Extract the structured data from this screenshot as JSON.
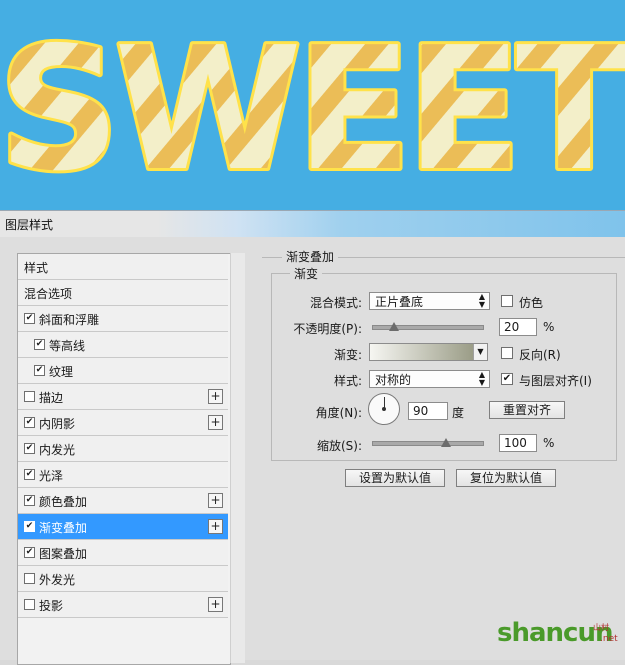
{
  "artwork": {
    "text": "SWEET",
    "background": "#45aee3",
    "fill": "#f3efc9",
    "stripe": "#eab84a",
    "outline": "#ffe24a"
  },
  "dialog_title": "图层样式",
  "style_list": [
    {
      "label": "样式",
      "checkbox": false,
      "checked": false,
      "indent": false,
      "plus": false,
      "selected": false
    },
    {
      "label": "混合选项",
      "checkbox": false,
      "checked": false,
      "indent": false,
      "plus": false,
      "selected": false
    },
    {
      "label": "斜面和浮雕",
      "checkbox": true,
      "checked": true,
      "indent": false,
      "plus": false,
      "selected": false
    },
    {
      "label": "等高线",
      "checkbox": true,
      "checked": true,
      "indent": true,
      "plus": false,
      "selected": false
    },
    {
      "label": "纹理",
      "checkbox": true,
      "checked": true,
      "indent": true,
      "plus": false,
      "selected": false
    },
    {
      "label": "描边",
      "checkbox": true,
      "checked": false,
      "indent": false,
      "plus": true,
      "selected": false
    },
    {
      "label": "内阴影",
      "checkbox": true,
      "checked": true,
      "indent": false,
      "plus": true,
      "selected": false
    },
    {
      "label": "内发光",
      "checkbox": true,
      "checked": true,
      "indent": false,
      "plus": false,
      "selected": false
    },
    {
      "label": "光泽",
      "checkbox": true,
      "checked": true,
      "indent": false,
      "plus": false,
      "selected": false
    },
    {
      "label": "颜色叠加",
      "checkbox": true,
      "checked": true,
      "indent": false,
      "plus": true,
      "selected": false
    },
    {
      "label": "渐变叠加",
      "checkbox": true,
      "checked": true,
      "indent": false,
      "plus": true,
      "selected": true
    },
    {
      "label": "图案叠加",
      "checkbox": true,
      "checked": true,
      "indent": false,
      "plus": false,
      "selected": false
    },
    {
      "label": "外发光",
      "checkbox": true,
      "checked": false,
      "indent": false,
      "plus": false,
      "selected": false
    },
    {
      "label": "投影",
      "checkbox": true,
      "checked": false,
      "indent": false,
      "plus": true,
      "selected": false
    }
  ],
  "panel": {
    "section_title": "渐变叠加",
    "group_title": "渐变",
    "blend_mode_label": "混合模式:",
    "blend_mode_value": "正片叠底",
    "dither_label": "仿色",
    "dither_checked": false,
    "opacity_label": "不透明度(P):",
    "opacity_value": "20",
    "opacity_unit": "%",
    "opacity_fraction": 0.2,
    "gradient_label": "渐变:",
    "gradient_colors": [
      "#f6f6f2",
      "#9a9c86"
    ],
    "reverse_label": "反向(R)",
    "reverse_checked": false,
    "style_label": "样式:",
    "style_value": "对称的",
    "align_label": "与图层对齐(I)",
    "align_checked": true,
    "angle_label": "角度(N):",
    "angle_value": "90",
    "angle_unit": "度",
    "reset_align_label": "重置对齐",
    "scale_label": "缩放(S):",
    "scale_value": "100",
    "scale_unit": "%",
    "scale_fraction": 0.67,
    "set_default_label": "设置为默认值",
    "reset_default_label": "复位为默认值"
  },
  "watermark": {
    "main": "shancun",
    "sub": "山村",
    "net": ".net"
  },
  "colors": {
    "selection": "#3399ff"
  }
}
